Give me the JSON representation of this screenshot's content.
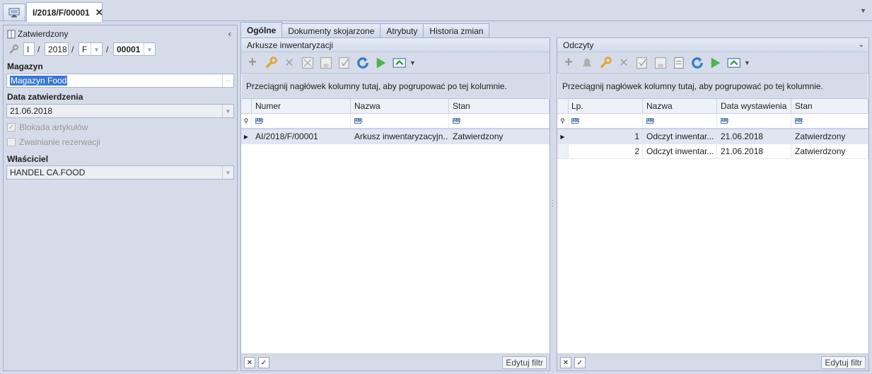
{
  "window": {
    "doc_tab_title": "I/2018/F/00001",
    "close_glyph": "✕"
  },
  "left": {
    "status": "Zatwierdzony",
    "number_parts": {
      "prefix": "I",
      "year": "2018",
      "series": "F",
      "number": "00001"
    },
    "slash": "/",
    "warehouse_label": "Magazyn",
    "warehouse_value": "Magazyn Food",
    "approval_date_label": "Data zatwierdzenia",
    "approval_date_value": "21.06.2018",
    "block_items_label": "Blokada artykułów",
    "release_reservations_label": "Zwalnianie rezerwacji",
    "owner_label": "Właściciel",
    "owner_value": "HANDEL CA.FOOD",
    "ellipsis": "···"
  },
  "tabs": [
    "Ogólne",
    "Dokumenty skojarzone",
    "Atrybuty",
    "Historia zmian"
  ],
  "sheets_pane": {
    "title": "Arkusze inwentaryzacji",
    "group_hint": "Przeciągnij nagłówek kolumny tutaj, aby pogrupować po tej kolumnie.",
    "columns": [
      "Numer",
      "Nazwa",
      "Stan"
    ],
    "rows": [
      {
        "numer": "AI/2018/F/00001",
        "nazwa": "Arkusz inwentaryzacyjn...",
        "stan": "Zatwierdzony"
      }
    ],
    "edit_filter": "Edytuj filtr"
  },
  "readings_pane": {
    "title": "Odczyty",
    "group_hint": "Przeciągnij nagłówek kolumny tutaj, aby pogrupować po tej kolumnie.",
    "columns": [
      "Lp.",
      "Nazwa",
      "Data wystawienia",
      "Stan"
    ],
    "rows": [
      {
        "lp": "1",
        "nazwa": "Odczyt inwentar...",
        "data": "21.06.2018",
        "stan": "Zatwierdzony"
      },
      {
        "lp": "2",
        "nazwa": "Odczyt inwentar...",
        "data": "21.06.2018",
        "stan": "Zatwierdzony"
      }
    ],
    "edit_filter": "Edytuj filtr"
  },
  "icons": {
    "add": "+",
    "edit": "wrench-icon",
    "delete": "✕",
    "refresh": "↻"
  }
}
